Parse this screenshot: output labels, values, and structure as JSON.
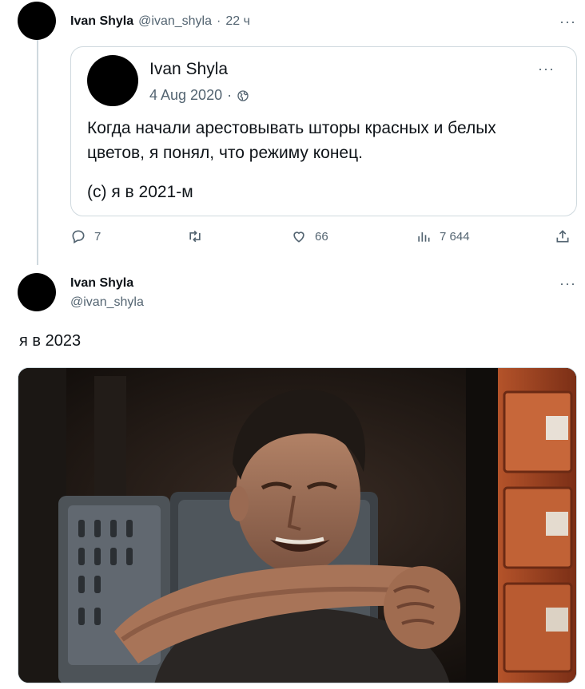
{
  "tweet1": {
    "name": "Ivan Shyla",
    "handle": "@ivan_shyla",
    "separator": "·",
    "time": "22 ч",
    "more": "···"
  },
  "quote": {
    "name": "Ivan Shyla",
    "date": "4 Aug 2020",
    "separator": "·",
    "text": "Когда начали арестовывать шторы красных и белых цветов, я понял, что режиму конец.",
    "signature": "(с) я в 2021-м",
    "more": "···"
  },
  "actions": {
    "replies": "7",
    "likes": "66",
    "views": "7 644"
  },
  "tweet2": {
    "name": "Ivan Shyla",
    "handle": "@ivan_shyla",
    "text": "я в 2023",
    "more": "···"
  },
  "colors": {
    "text": "#0f1419",
    "muted": "#536471",
    "border": "#cfd9de"
  },
  "icons": [
    "reply-icon",
    "retweet-icon",
    "like-icon",
    "views-icon",
    "share-icon",
    "globe-icon",
    "more-icon"
  ]
}
